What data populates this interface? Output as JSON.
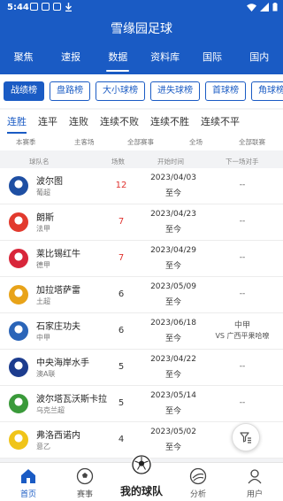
{
  "status_bar": {
    "time": "5:44"
  },
  "app": {
    "title": "雪缘园足球"
  },
  "nav_tabs": [
    {
      "label": "聚焦"
    },
    {
      "label": "速报"
    },
    {
      "label": "数据",
      "active": true
    },
    {
      "label": "资料库"
    },
    {
      "label": "国际"
    },
    {
      "label": "国内"
    }
  ],
  "chips": [
    {
      "label": "战绩榜",
      "active": true
    },
    {
      "label": "盘路榜"
    },
    {
      "label": "大小球榜"
    },
    {
      "label": "进失球榜"
    },
    {
      "label": "首球榜"
    },
    {
      "label": "角球榜"
    }
  ],
  "sub_tabs": [
    {
      "label": "连胜",
      "active": true
    },
    {
      "label": "连平"
    },
    {
      "label": "连败"
    },
    {
      "label": "连续不败"
    },
    {
      "label": "连续不胜"
    },
    {
      "label": "连续不平"
    }
  ],
  "filters": {
    "season": "本赛季",
    "venue": "主客场",
    "events": "全部赛事",
    "half": "全场",
    "leagues": "全部联赛"
  },
  "table_headers": {
    "team": "球队名",
    "count": "场数",
    "start": "开始时间",
    "next_opponent": "下一场对手"
  },
  "rows": [
    {
      "team": "波尔图",
      "league": "葡超",
      "count": "12",
      "hot": true,
      "start": "2023/04/03",
      "to": "至今",
      "opponent": "--",
      "badge_color": "#1e4fa3"
    },
    {
      "team": "朗斯",
      "league": "法甲",
      "count": "7",
      "hot": true,
      "start": "2023/04/23",
      "to": "至今",
      "opponent": "--",
      "badge_color": "#e23a2e"
    },
    {
      "team": "莱比锡红牛",
      "league": "德甲",
      "count": "7",
      "hot": true,
      "start": "2023/04/29",
      "to": "至今",
      "opponent": "--",
      "badge_color": "#d8263a"
    },
    {
      "team": "加拉塔萨雷",
      "league": "土超",
      "count": "6",
      "hot": false,
      "start": "2023/05/09",
      "to": "至今",
      "opponent": "--",
      "badge_color": "#e8a319"
    },
    {
      "team": "石家庄功夫",
      "league": "中甲",
      "count": "6",
      "hot": false,
      "start": "2023/06/18",
      "to": "至今",
      "opponent_line1": "中甲",
      "opponent_line2": "VS 广西平果哈嘹",
      "badge_color": "#2b65b8"
    },
    {
      "team": "中央海岸水手",
      "league": "澳A联",
      "count": "5",
      "hot": false,
      "start": "2023/04/22",
      "to": "至今",
      "opponent": "--",
      "badge_color": "#1c3c8e"
    },
    {
      "team": "波尔塔瓦沃斯卡拉",
      "league": "乌克兰超",
      "count": "5",
      "hot": false,
      "start": "2023/05/14",
      "to": "至今",
      "opponent": "--",
      "badge_color": "#3a9a3a"
    },
    {
      "team": "弗洛西诺内",
      "league": "意乙",
      "count": "4",
      "hot": false,
      "start": "2023/05/02",
      "to": "至今",
      "opponent": "--",
      "badge_color": "#f0c419"
    }
  ],
  "bottom_nav": [
    {
      "label": "首页",
      "active": true
    },
    {
      "label": "赛事"
    },
    {
      "label": "我的球队"
    },
    {
      "label": "分析"
    },
    {
      "label": "用户"
    }
  ],
  "colors": {
    "primary": "#1a5bc4",
    "hot": "#e0322e"
  }
}
